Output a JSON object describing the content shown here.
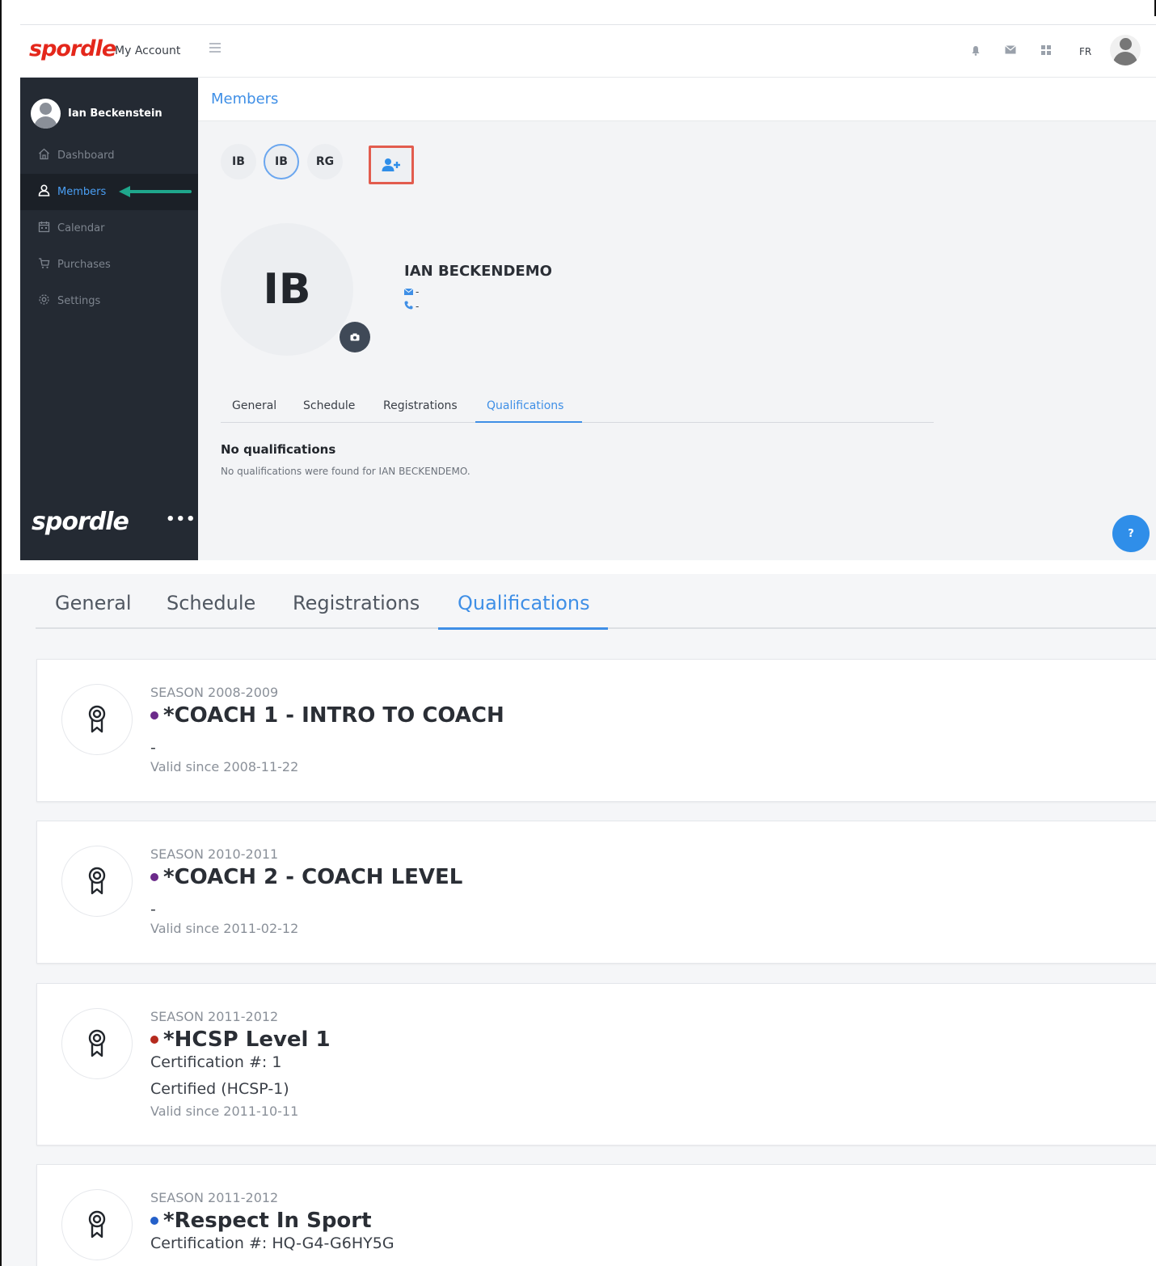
{
  "header": {
    "logo_text": "spordle",
    "app_name": "My Account",
    "language": "FR",
    "icons": [
      "bell-icon",
      "mail-icon",
      "apps-grid-icon",
      "user-avatar-icon"
    ]
  },
  "sidebar": {
    "user_name": "Ian Beckenstein",
    "items": [
      {
        "label": "Dashboard",
        "icon": "home-icon"
      },
      {
        "label": "Members",
        "icon": "user-icon",
        "active": true
      },
      {
        "label": "Calendar",
        "icon": "calendar-icon"
      },
      {
        "label": "Purchases",
        "icon": "cart-icon"
      },
      {
        "label": "Settings",
        "icon": "gear-icon"
      }
    ],
    "footer_logo": "spordle",
    "more_label": "•••"
  },
  "page": {
    "title": "Members",
    "members": [
      {
        "initials": "IB",
        "selected": false
      },
      {
        "initials": "IB",
        "selected": true
      },
      {
        "initials": "RG",
        "selected": false
      }
    ],
    "profile": {
      "initials": "IB",
      "name": "IAN BECKENDEMO",
      "email": "-",
      "phone": "-"
    },
    "tabs": [
      "General",
      "Schedule",
      "Registrations",
      "Qualifications"
    ],
    "active_tab": "Qualifications",
    "empty_title": "No qualifications",
    "empty_text": "No qualifications were found for IAN BECKENDEMO.",
    "help_label": "?"
  },
  "zoom": {
    "tabs": [
      "General",
      "Schedule",
      "Registrations",
      "Qualifications"
    ],
    "active_tab": "Qualifications",
    "qualifications": [
      {
        "season": "SEASON 2008-2009",
        "name": "*COACH 1 - INTRO TO COACH",
        "dot_color": "#6b2a8a",
        "line1": "",
        "line2": "-",
        "valid": "Valid since 2008-11-22"
      },
      {
        "season": "SEASON 2010-2011",
        "name": "*COACH 2 - COACH LEVEL",
        "dot_color": "#6b2a8a",
        "line1": "",
        "line2": "-",
        "valid": "Valid since 2011-02-12"
      },
      {
        "season": "SEASON 2011-2012",
        "name": "*HCSP Level 1",
        "dot_color": "#b52a1e",
        "line1": "Certification #: 1",
        "line2": "Certified (HCSP-1)",
        "valid": "Valid since 2011-10-11"
      },
      {
        "season": "SEASON 2011-2012",
        "name": "*Respect In Sport",
        "dot_color": "#2460c9",
        "line1": "Certification #: HQ-G4-G6HY5G",
        "line2": "",
        "valid": ""
      }
    ]
  },
  "colors": {
    "brand_red": "#e4271b",
    "accent_blue": "#3f8fe6",
    "sidebar_bg": "#242a33",
    "highlight_box": "#e25c4e",
    "arrow_green": "#1fa78c"
  }
}
